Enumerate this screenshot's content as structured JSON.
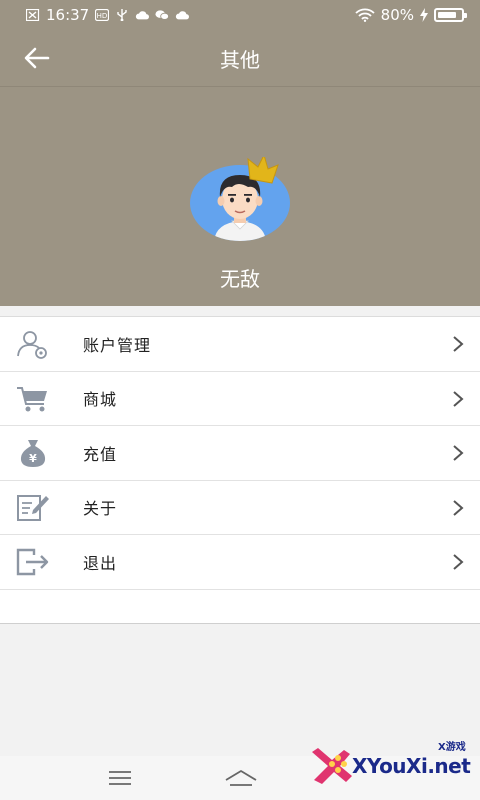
{
  "status_bar": {
    "time": "16:37",
    "battery_text": "80%",
    "battery_level": 0.8,
    "icons": [
      "close-notification-icon",
      "hd-icon",
      "usb-icon",
      "cloud-icon",
      "wechat-icon",
      "cloud-icon",
      "wifi-icon",
      "battery-icon",
      "charging-icon"
    ]
  },
  "titlebar": {
    "title": "其他",
    "back_icon": "arrow-left-icon"
  },
  "profile": {
    "username": "无敌",
    "avatar_icon": "crowned-avatar-icon"
  },
  "menu": {
    "items": [
      {
        "label": "账户管理",
        "icon": "user-settings-icon"
      },
      {
        "label": "商城",
        "icon": "cart-icon"
      },
      {
        "label": "充值",
        "icon": "money-bag-icon"
      },
      {
        "label": "关于",
        "icon": "edit-document-icon"
      },
      {
        "label": "退出",
        "icon": "logout-icon"
      }
    ]
  },
  "colors": {
    "header": "#9c9484",
    "icon": "#8d96a3",
    "text": "#222222",
    "divider": "#e2e2e2"
  },
  "watermark": {
    "text": "XYouXi.net",
    "sub": "X游戏"
  }
}
